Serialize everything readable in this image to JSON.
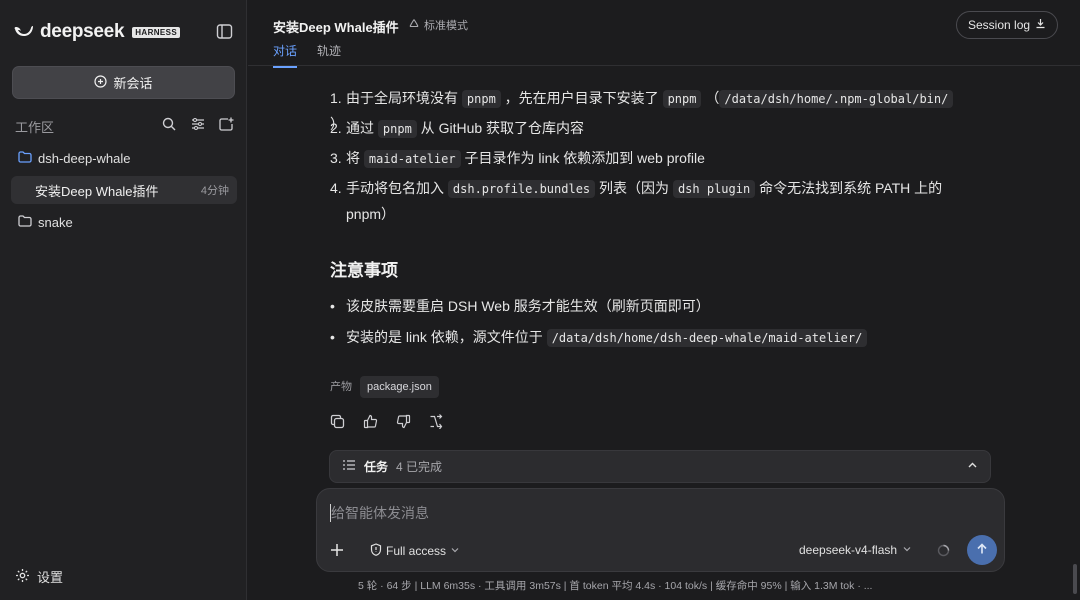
{
  "brand": {
    "name": "deepseek",
    "badge": "HARNESS"
  },
  "sidebar": {
    "new_chat_label": "新会话",
    "workspace_label": "工作区",
    "folders": [
      {
        "name": "dsh-deep-whale",
        "open": true,
        "threads": [
          {
            "title": "安装Deep Whale插件",
            "time": "4分钟"
          }
        ]
      },
      {
        "name": "snake",
        "open": false
      }
    ],
    "settings_label": "设置"
  },
  "header": {
    "title": "安装Deep Whale插件",
    "mode": "标准模式",
    "tabs": [
      {
        "label": "对话",
        "active": true
      },
      {
        "label": "轨迹",
        "active": false
      }
    ],
    "session_log_label": "Session log"
  },
  "message": {
    "ordered_list": [
      {
        "num": "1.",
        "parts": [
          {
            "t": "由于全局环境没有 "
          },
          {
            "c": "pnpm"
          },
          {
            "t": " ，先在用户目录下安装了 "
          },
          {
            "c": "pnpm"
          },
          {
            "t": " （"
          },
          {
            "c": "/data/dsh/home/.npm-global/bin/"
          },
          {
            "t": " ）"
          }
        ]
      },
      {
        "num": "2.",
        "parts": [
          {
            "t": "通过 "
          },
          {
            "c": "pnpm"
          },
          {
            "t": " 从 GitHub 获取了仓库内容"
          }
        ]
      },
      {
        "num": "3.",
        "parts": [
          {
            "t": "将 "
          },
          {
            "c": "maid-atelier"
          },
          {
            "t": " 子目录作为 link 依赖添加到 web profile"
          }
        ]
      },
      {
        "num": "4.",
        "parts": [
          {
            "t": "手动将包名加入 "
          },
          {
            "c": "dsh.profile.bundles"
          },
          {
            "t": " 列表（因为 "
          },
          {
            "c": "dsh plugin"
          },
          {
            "t": " 命令无法找到系统 PATH 上的"
          }
        ],
        "cont": "pnpm）"
      }
    ],
    "heading": "注意事项",
    "bullets": [
      {
        "parts": [
          {
            "t": "该皮肤需要重启 DSH Web 服务才能生效（刷新页面即可）"
          }
        ]
      },
      {
        "parts": [
          {
            "t": "安装的是 link 依赖，源文件位于 "
          },
          {
            "c": "/data/dsh/home/dsh-deep-whale/maid-atelier/"
          }
        ]
      }
    ],
    "artifact_label": "产物",
    "artifact_file": "package.json"
  },
  "tasks": {
    "title": "任务",
    "status": "4 已完成"
  },
  "composer": {
    "placeholder": "给智能体发消息",
    "access_label": "Full access",
    "model_label": "deepseek-v4-flash"
  },
  "statusbar": {
    "text": "5 轮 · 64 步   |   LLM 6m35s · 工具调用 3m57s   |   首 token 平均 4.4s · 104 tok/s   |   缓存命中 95%   |   输入 1.3M tok · ..."
  },
  "colors": {
    "accent": "#6aa1ff",
    "send_button": "#4a6fae"
  },
  "icons": [
    "whale-logo-icon",
    "sidebar-toggle-icon",
    "plus-circle-icon",
    "search-icon",
    "filter-icon",
    "new-folder-icon",
    "folder-open-icon",
    "folder-icon",
    "gear-icon",
    "recycle-icon",
    "download-icon",
    "copy-icon",
    "thumbs-up-icon",
    "thumbs-down-icon",
    "retry-icon",
    "checklist-icon",
    "chevron-up-icon",
    "plus-icon",
    "shield-icon",
    "chevron-down-icon",
    "spinner-icon",
    "arrow-up-icon"
  ]
}
